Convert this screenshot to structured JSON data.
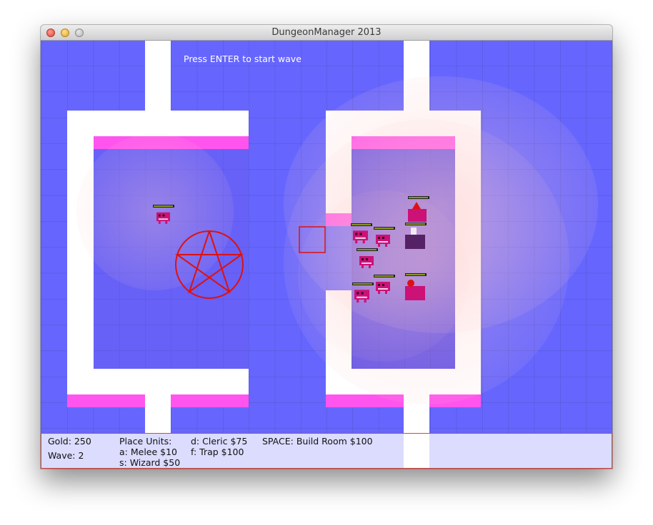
{
  "window": {
    "title": "DungeonManager 2013"
  },
  "game": {
    "prompt": "Press ENTER to start wave"
  },
  "status": {
    "gold": "Gold: 250",
    "wave": "Wave: 2",
    "place_units": "Place Units:",
    "melee": "a: Melee $10",
    "wizard": "s: Wizard $50",
    "cleric": "d: Cleric $75",
    "trap": "f: Trap $100",
    "build_room": "SPACE: Build Room $100"
  },
  "colors": {
    "floor": "#6666ff",
    "wall": "#ffffff",
    "door_strip": "#ff55ee",
    "room_floor": "#6a5ae8",
    "pentagram": "#dd1111",
    "health_fill": "#889922"
  },
  "icons": [
    "pentagram-icon",
    "monster-sprite",
    "cleric-sprite",
    "selection-cursor"
  ]
}
